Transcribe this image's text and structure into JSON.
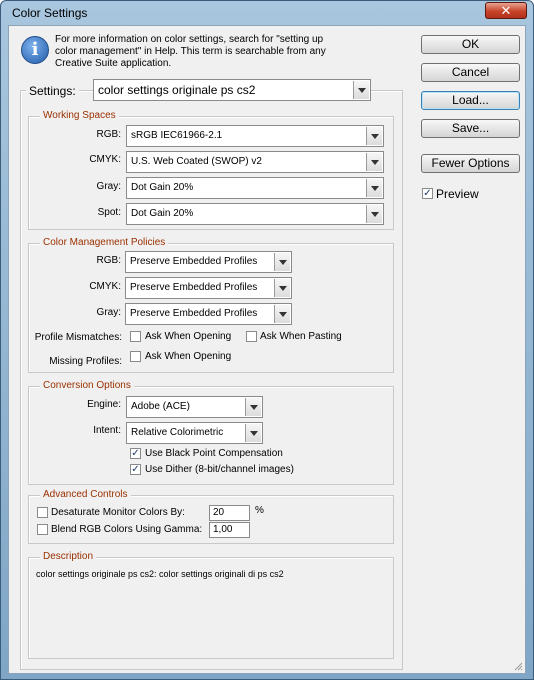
{
  "window": {
    "title": "Color Settings",
    "close_glyph": "✕"
  },
  "info": {
    "icon": "info-icon",
    "line1": "For more information on color settings, search for \"setting up",
    "line2": "color management\" in Help. This term is searchable from any",
    "line3": "Creative Suite application."
  },
  "buttons": {
    "ok": "OK",
    "cancel": "Cancel",
    "load": "Load...",
    "save": "Save...",
    "fewer_options": "Fewer Options"
  },
  "preview": {
    "label": "Preview",
    "checked": true
  },
  "settings": {
    "label": "Settings:",
    "value": "color settings originale ps cs2"
  },
  "working_spaces": {
    "title": "Working Spaces",
    "rgb_label": "RGB:",
    "rgb_value": "sRGB IEC61966-2.1",
    "cmyk_label": "CMYK:",
    "cmyk_value": "U.S. Web Coated (SWOP) v2",
    "gray_label": "Gray:",
    "gray_value": "Dot Gain 20%",
    "spot_label": "Spot:",
    "spot_value": "Dot Gain 20%"
  },
  "policies": {
    "title": "Color Management Policies",
    "rgb_label": "RGB:",
    "rgb_value": "Preserve Embedded Profiles",
    "cmyk_label": "CMYK:",
    "cmyk_value": "Preserve Embedded Profiles",
    "gray_label": "Gray:",
    "gray_value": "Preserve Embedded Profiles",
    "mismatch_label": "Profile Mismatches:",
    "ask_opening": "Ask When Opening",
    "ask_pasting": "Ask When Pasting",
    "missing_label": "Missing Profiles:",
    "missing_ask_opening": "Ask When Opening"
  },
  "conversion": {
    "title": "Conversion Options",
    "engine_label": "Engine:",
    "engine_value": "Adobe (ACE)",
    "intent_label": "Intent:",
    "intent_value": "Relative Colorimetric",
    "black_point": "Use Black Point Compensation",
    "dither": "Use Dither (8-bit/channel images)"
  },
  "advanced": {
    "title": "Advanced Controls",
    "desaturate_label": "Desaturate Monitor Colors By:",
    "desaturate_value": "20",
    "percent": "%",
    "blend_label": "Blend RGB Colors Using Gamma:",
    "blend_value": "1,00"
  },
  "description": {
    "title": "Description",
    "text": "color settings originale ps cs2:  color settings originali di ps cs2"
  },
  "check_glyph": "✓"
}
